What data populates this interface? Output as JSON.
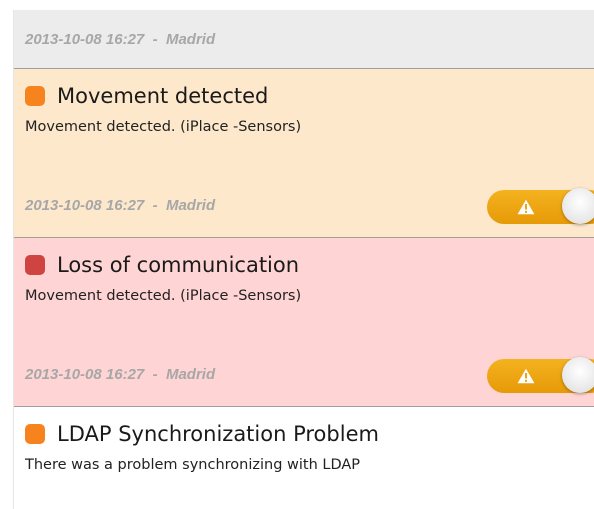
{
  "feed": {
    "top_meta": {
      "date": "2013-10-08 16:27",
      "separator": "-",
      "location": "Madrid"
    },
    "events": [
      {
        "severity": "warning",
        "severity_color": "#f7831f",
        "title": "Movement detected",
        "description": "Movement detected. (iPlace -Sensors)",
        "date": "2013-10-08 16:27",
        "separator": "-",
        "location": "Madrid",
        "toggle_icon": "warning-icon",
        "toggle_color": "#eda414"
      },
      {
        "severity": "critical",
        "severity_color": "#cf4341",
        "title": "Loss of communication",
        "description": "Movement detected. (iPlace -Sensors)",
        "date": "2013-10-08 16:27",
        "separator": "-",
        "location": "Madrid",
        "toggle_icon": "warning-icon",
        "toggle_color": "#eda414"
      },
      {
        "severity": "warning",
        "severity_color": "#f7831f",
        "title": "LDAP Synchronization Problem",
        "description": "There was a problem synchronizing with LDAP"
      }
    ]
  }
}
